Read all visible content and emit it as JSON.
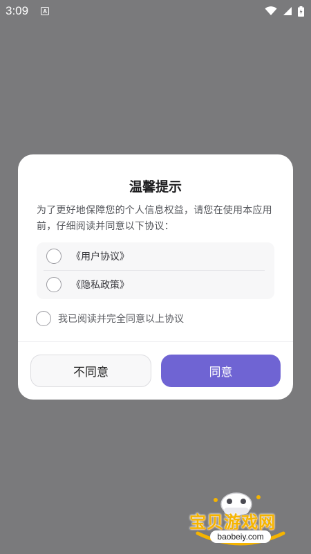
{
  "status_bar": {
    "time": "3:09",
    "notification_icon": "a-box-icon",
    "wifi_icon": "wifi-icon",
    "signal_icon": "signal-icon",
    "battery_icon": "battery-icon"
  },
  "dialog": {
    "title": "温馨提示",
    "body": "为了更好地保障您的个人信息权益，请您在使用本应用前，仔细阅读并同意以下协议：",
    "agreements": [
      {
        "label": "《用户协议》"
      },
      {
        "label": "《隐私政策》"
      }
    ],
    "consent_label": "我已阅读并完全同意以上协议",
    "disagree_label": "不同意",
    "agree_label": "同意",
    "accent_color": "#6f64d3"
  },
  "watermark": {
    "brand": "宝贝游戏网",
    "url": "baobeiy.com"
  }
}
